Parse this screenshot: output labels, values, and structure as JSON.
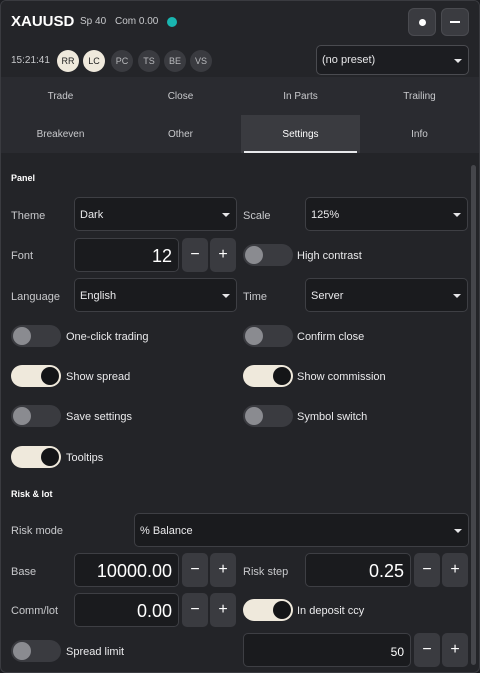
{
  "header": {
    "symbol": "XAUUSD",
    "spread": "Sp 40",
    "commission": "Com 0.00",
    "status_color": "#19b6b0",
    "time": "15:21:41",
    "pills": [
      {
        "label": "RR",
        "active": true
      },
      {
        "label": "LC",
        "active": true
      },
      {
        "label": "PC",
        "active": false
      },
      {
        "label": "TS",
        "active": false
      },
      {
        "label": "BE",
        "active": false
      },
      {
        "label": "VS",
        "active": false
      }
    ],
    "preset_value": "(no preset)",
    "btn_dot_icon": "record-dot-icon",
    "btn_minimize_icon": "minimize-icon"
  },
  "tabs": [
    "Trade",
    "Close",
    "In Parts",
    "Trailing",
    "Breakeven",
    "Other",
    "Settings",
    "Info"
  ],
  "active_tab": "Settings",
  "panel": {
    "title": "Panel",
    "theme_label": "Theme",
    "theme_value": "Dark",
    "scale_label": "Scale",
    "scale_value": "125%",
    "font_label": "Font",
    "font_value": "12",
    "high_contrast_label": "High contrast",
    "high_contrast_on": false,
    "language_label": "Language",
    "language_value": "English",
    "time_label": "Time",
    "time_value": "Server",
    "one_click_label": "One-click trading",
    "one_click_on": false,
    "confirm_close_label": "Confirm close",
    "confirm_close_on": false,
    "show_spread_label": "Show spread",
    "show_spread_on": true,
    "show_commission_label": "Show commission",
    "show_commission_on": true,
    "save_settings_label": "Save settings",
    "save_settings_on": false,
    "symbol_switch_label": "Symbol switch",
    "symbol_switch_on": false,
    "tooltips_label": "Tooltips",
    "tooltips_on": true
  },
  "risk": {
    "title": "Risk & lot",
    "risk_mode_label": "Risk mode",
    "risk_mode_value": "% Balance",
    "base_label": "Base",
    "base_value": "10000.00",
    "risk_step_label": "Risk step",
    "risk_step_value": "0.25",
    "comm_lot_label": "Comm/lot",
    "comm_lot_value": "0.00",
    "in_deposit_label": "In deposit ccy",
    "in_deposit_on": true,
    "spread_limit_label": "Spread limit",
    "spread_limit_on": false,
    "spread_limit_value": "50"
  },
  "stepper": {
    "minus": "−",
    "plus": "+"
  }
}
